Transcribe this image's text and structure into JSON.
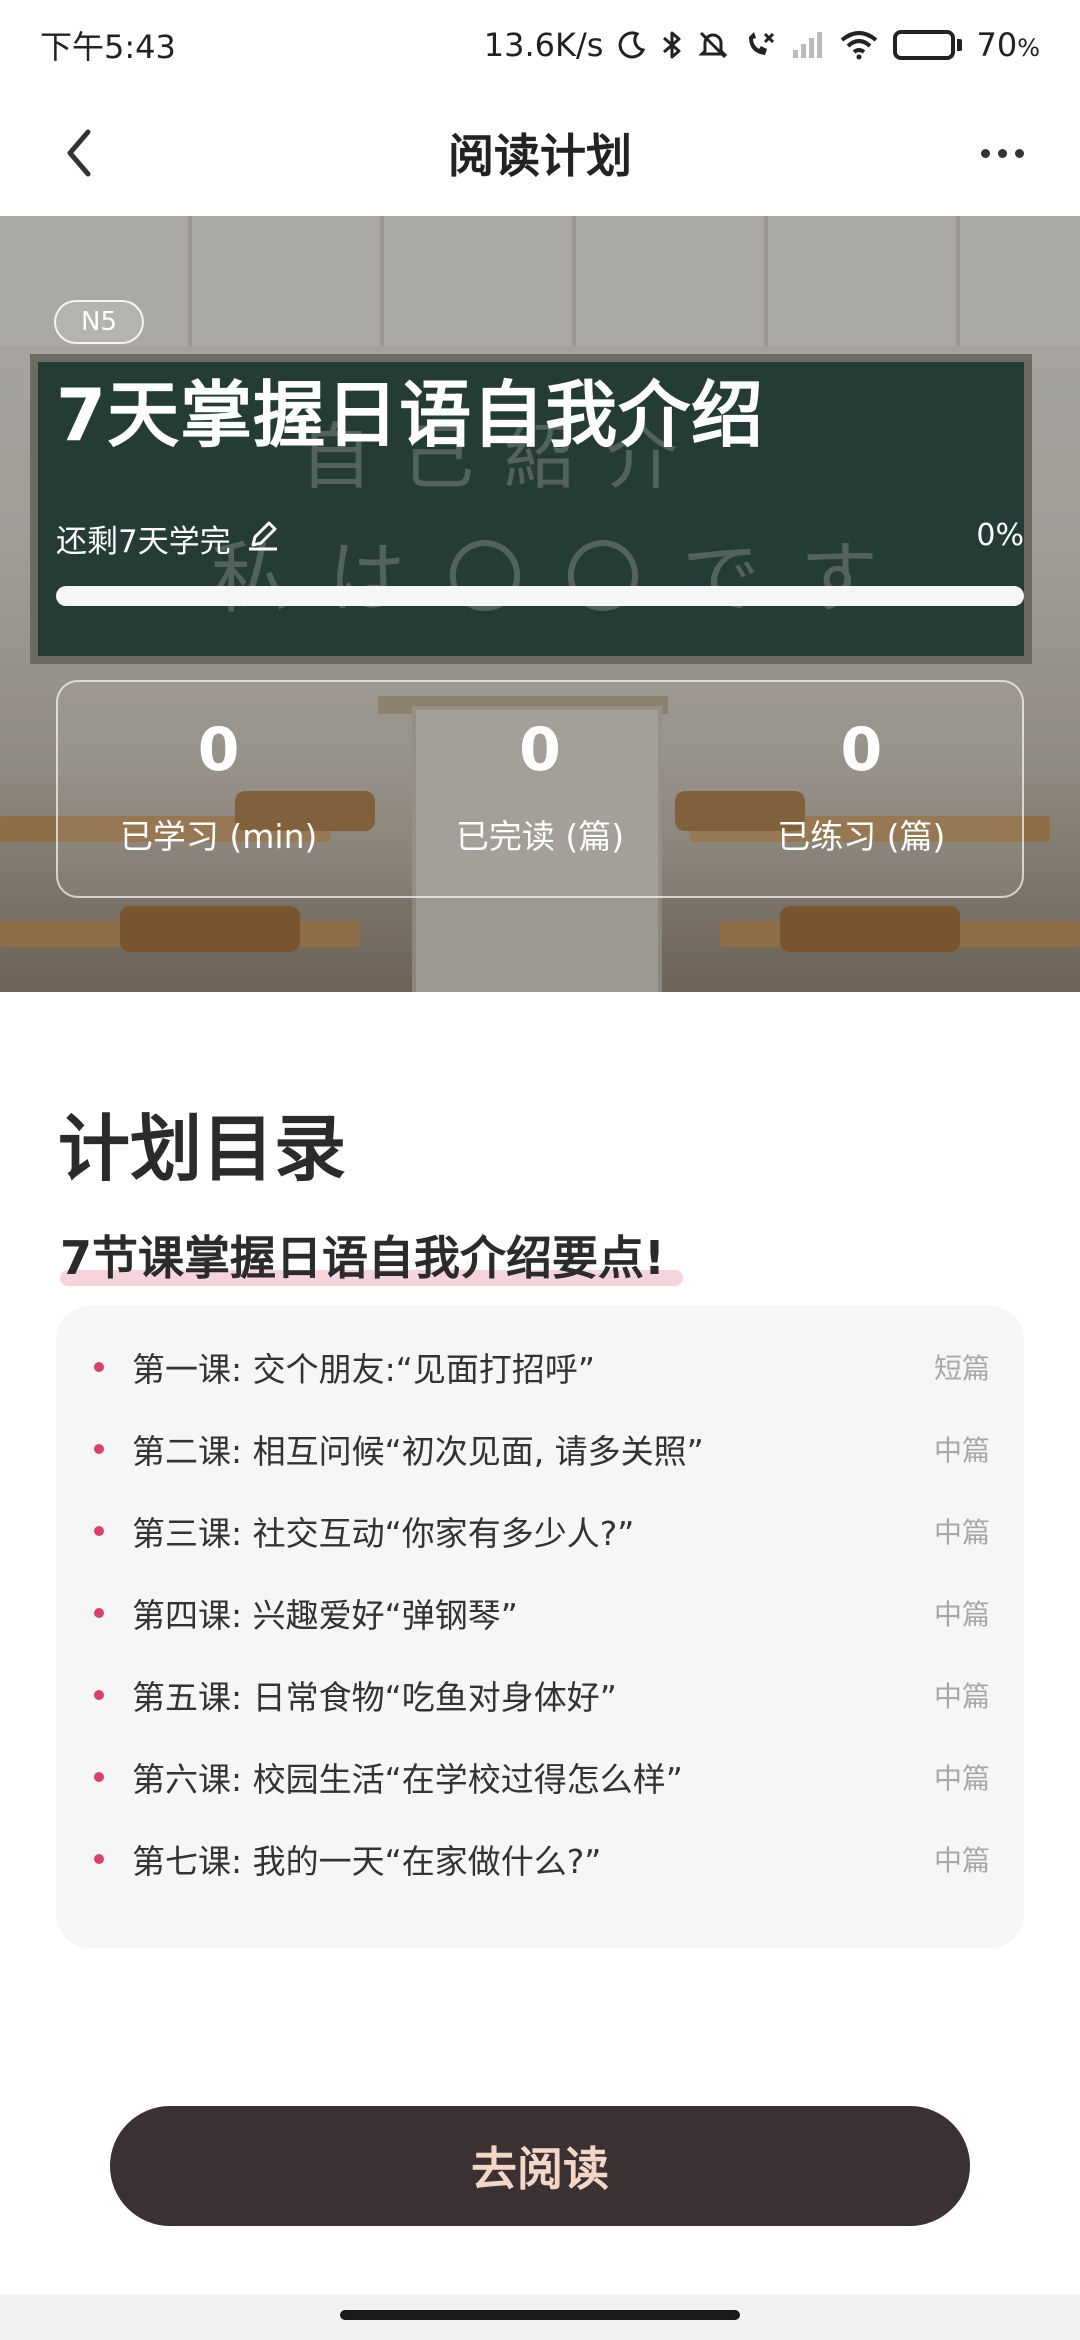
{
  "status_bar": {
    "time": "下午5:43",
    "net_speed": "13.6K/s",
    "battery": "70",
    "battery_unit": "%",
    "battery_level": 0.7
  },
  "nav": {
    "title": "阅读计划"
  },
  "plan": {
    "level": "N5",
    "title": "7天掌握日语自我介绍",
    "remaining": "还剩7天学完",
    "progress_text": "0%",
    "progress": 0,
    "chalkboard_line1": "自己紹介",
    "chalkboard_line2": "私は〇〇です",
    "stats": [
      {
        "value": "0",
        "label": "已学习 (min)"
      },
      {
        "value": "0",
        "label": "已完读 (篇)"
      },
      {
        "value": "0",
        "label": "已练习 (篇)"
      }
    ]
  },
  "catalog": {
    "title": "计划目录",
    "subtitle": "7节课掌握日语自我介绍要点!",
    "lessons": [
      {
        "name": "第一课: 交个朋友:“见面打招呼”",
        "tag": "短篇"
      },
      {
        "name": "第二课: 相互问候“初次见面, 请多关照”",
        "tag": "中篇"
      },
      {
        "name": "第三课: 社交互动“你家有多少人?”",
        "tag": "中篇"
      },
      {
        "name": "第四课: 兴趣爱好“弹钢琴”",
        "tag": "中篇"
      },
      {
        "name": "第五课: 日常食物“吃鱼对身体好”",
        "tag": "中篇"
      },
      {
        "name": "第六课: 校园生活“在学校过得怎么样”",
        "tag": "中篇"
      },
      {
        "name": "第七课: 我的一天“在家做什么?”",
        "tag": "中篇"
      }
    ]
  },
  "actions": {
    "read_label": "去阅读"
  },
  "colors": {
    "button_bg": "#3b3132",
    "button_text": "#f3d7c6",
    "bullet": "#d9406a",
    "highlight": "#f7d3dc"
  }
}
